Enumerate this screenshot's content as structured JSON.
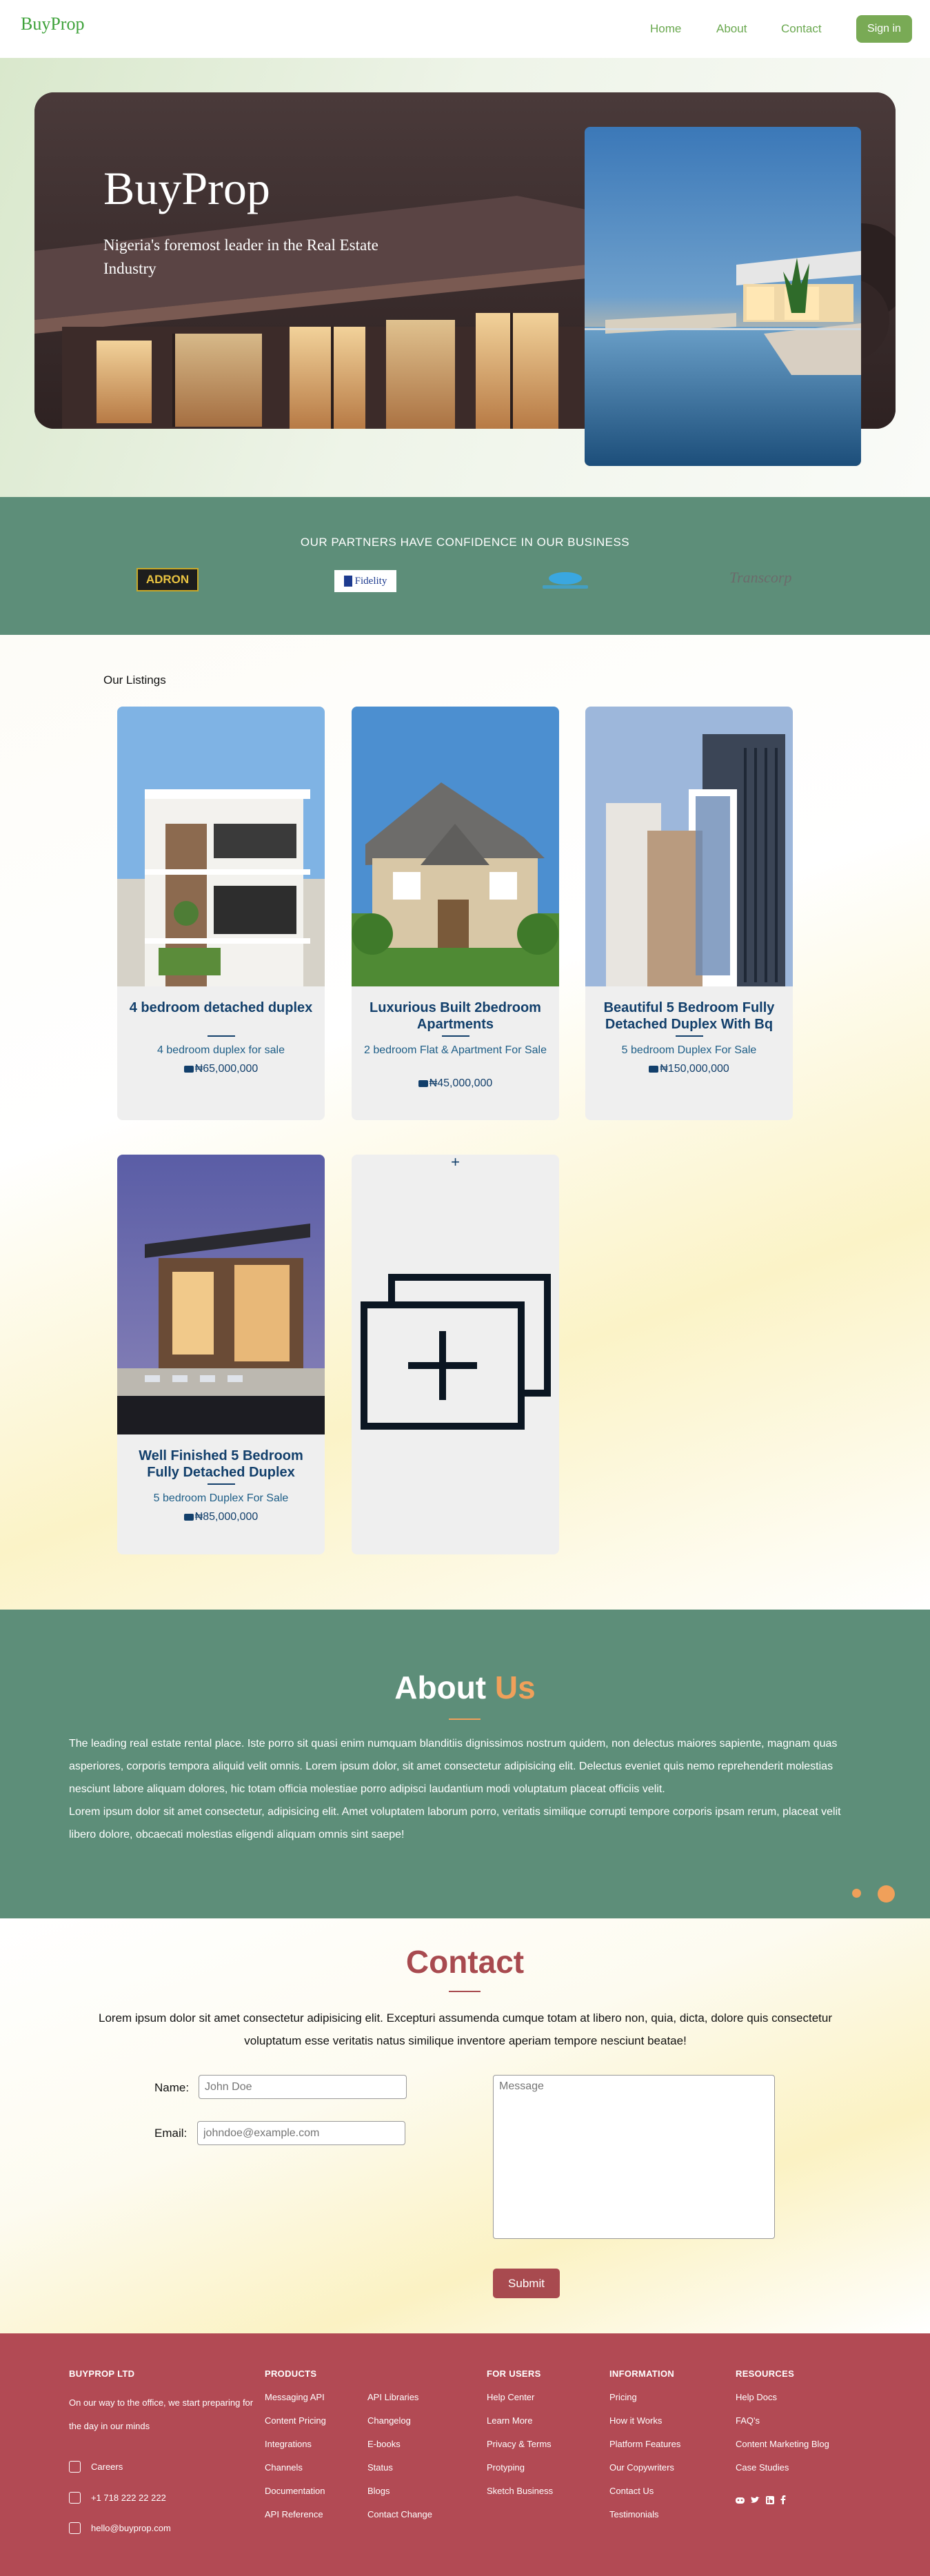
{
  "nav": {
    "logo": "BuyProp",
    "links": [
      "Home",
      "About",
      "Contact"
    ],
    "signin": "Sign in"
  },
  "hero": {
    "title": "BuyProp",
    "subtitle": "Nigeria's foremost leader in the Real Estate Industry"
  },
  "partners": {
    "title": "OUR PARTNERS HAVE CONFIDENCE IN OUR BUSINESS",
    "logos": [
      "ADRON",
      "Fidelity",
      "Transcorp"
    ]
  },
  "listings": {
    "title": "Our Listings",
    "items": [
      {
        "title": "4 bedroom detached duplex",
        "desc": "4 bedroom duplex for sale",
        "price": "₦65,000,000"
      },
      {
        "title": "Luxurious Built 2bedroom Apartments",
        "desc": "2 bedroom Flat & Apartment For Sale",
        "price": "₦45,000,000"
      },
      {
        "title": "Beautiful 5 Bedroom Fully Detached Duplex With Bq",
        "desc": "5 bedroom Duplex For Sale",
        "price": "₦150,000,000"
      },
      {
        "title": "Well Finished 5 Bedroom Fully Detached Duplex",
        "desc": "5 bedroom Duplex For Sale",
        "price": "₦85,000,000"
      }
    ],
    "add_label": "+"
  },
  "about": {
    "title_a": "About",
    "title_b": "Us",
    "p1": "The leading real estate rental place. Iste porro sit quasi enim numquam blanditiis dignissimos nostrum quidem, non delectus maiores sapiente, magnam quas asperiores, corporis tempora aliquid velit omnis. Lorem ipsum dolor, sit amet consectetur adipisicing elit. Delectus eveniet quis nemo reprehenderit molestias nesciunt labore aliquam dolores, hic totam officia molestiae porro adipisci laudantium modi voluptatum placeat officiis velit.",
    "p2": "Lorem ipsum dolor sit amet consectetur, adipisicing elit. Amet voluptatem laborum porro, veritatis similique corrupti tempore corporis ipsam rerum, placeat velit libero dolore, obcaecati molestias eligendi aliquam omnis sint saepe!",
    "accent": "#f0a05a"
  },
  "contact": {
    "title": "Contact",
    "text": "Lorem ipsum dolor sit amet consectetur adipisicing elit. Excepturi assumenda cumque totam at libero non, quia, dicta, dolore quis consectetur voluptatum esse veritatis natus similique inventore aperiam tempore nesciunt beatae!",
    "name_label": "Name:",
    "name_placeholder": "John Doe",
    "email_label": "Email:",
    "email_placeholder": "johndoe@example.com",
    "message_placeholder": "Message",
    "submit": "Submit"
  },
  "footer": {
    "company": {
      "heading": "BUYPROP LTD",
      "tagline": "On our way to the office, we start preparing for the day in our minds",
      "careers": "Careers",
      "phone": "+1 718 222 22 222",
      "email": "hello@buyprop.com"
    },
    "products": {
      "heading": "PRODUCTS",
      "col1": [
        "Messaging API",
        "Content Pricing",
        "Integrations",
        "Channels",
        "Documentation",
        "API Reference"
      ],
      "col2": [
        "API Libraries",
        "Changelog",
        "E-books",
        "Status",
        "Blogs",
        "Contact Change"
      ]
    },
    "for_users": {
      "heading": "FOR USERS",
      "items": [
        "Help Center",
        "Learn More",
        "Privacy & Terms",
        "Protyping",
        "Sketch Business"
      ]
    },
    "information": {
      "heading": "INFORMATION",
      "items": [
        "Pricing",
        "How it Works",
        "Platform Features",
        "Our Copywriters",
        "Contact Us",
        "Testimonials"
      ]
    },
    "resources": {
      "heading": "RESOURCES",
      "items": [
        "Help Docs",
        "FAQ's",
        "Content Marketing Blog",
        "Case Studies"
      ],
      "social": [
        "discord-icon",
        "twitter-icon",
        "linkedin-icon",
        "facebook-icon"
      ]
    }
  }
}
